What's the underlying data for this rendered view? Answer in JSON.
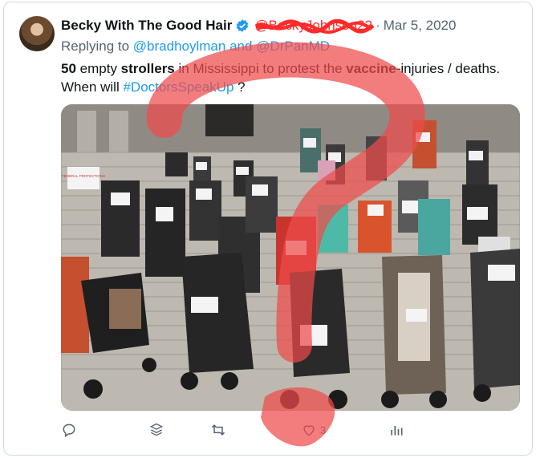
{
  "tweet": {
    "display_name": "Becky With The Good Hair",
    "handle": "@BeckyJohnson22",
    "separator": "·",
    "date": "Mar 5, 2020",
    "replying_prefix": "Replying to",
    "replying_user1": "@bradhoylman",
    "replying_and": "and",
    "replying_user2": "@DrPanMD",
    "text": {
      "t1": "50",
      "t2": " empty ",
      "t3": "strollers",
      "t4": " in Mississippi to protest the ",
      "t5": "vaccine",
      "t6": "-injuries / deaths.",
      "t7": "When will ",
      "t8": "#DoctorsSpeakUp",
      "t9": " ?"
    },
    "sign_left": "FEDERAL PROTECTIONS",
    "like_count": "3"
  },
  "colors": {
    "link": "#1d9bf0",
    "verified": "#1d9bf0",
    "annotation": "#ef4b4b",
    "redaction": "#ff2a2a",
    "muted": "#536471"
  },
  "icons": [
    "reply-icon",
    "grok-icon",
    "retweet-icon",
    "like-icon",
    "views-icon",
    "verified-icon"
  ]
}
